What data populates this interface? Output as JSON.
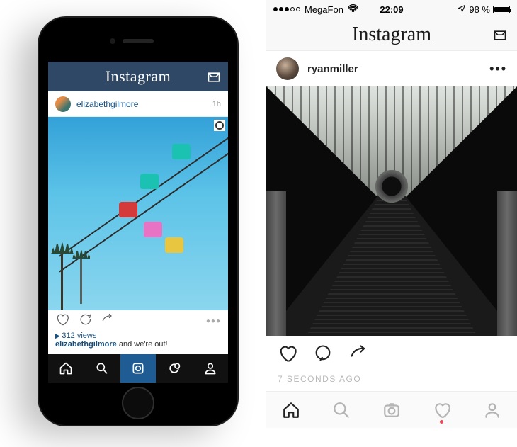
{
  "left": {
    "header_logo": "Instagram",
    "user": {
      "name": "elizabethgilmore",
      "timestamp": "1h"
    },
    "views_text": "312 views",
    "caption_user": "elizabethgilmore",
    "caption_text": " and we're out!",
    "tabs": [
      "home",
      "search",
      "camera",
      "activity",
      "profile"
    ]
  },
  "right": {
    "status": {
      "carrier": "MegaFon",
      "time": "22:09",
      "battery_pct": "98 %"
    },
    "header_logo": "Instagram",
    "user": {
      "name": "ryanmiller"
    },
    "timestamp": "7 SECONDS AGO",
    "tabs": [
      "home",
      "search",
      "camera",
      "activity",
      "profile"
    ]
  }
}
